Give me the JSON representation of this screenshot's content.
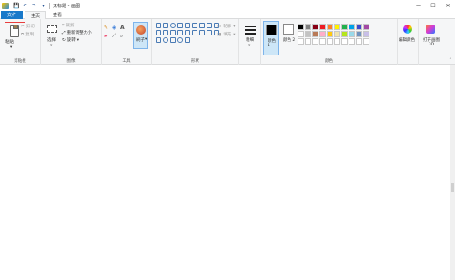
{
  "titlebar": {
    "title": "无标题 - 画图",
    "quick_access": [
      "save-icon",
      "undo-icon",
      "redo-icon",
      "customize-icon"
    ],
    "window_controls": {
      "minimize": "—",
      "maximize": "☐",
      "close": "✕"
    }
  },
  "tabs": {
    "file": "文件",
    "home": "主页",
    "view": "查看"
  },
  "clipboard": {
    "paste": "粘贴",
    "cut": "剪切",
    "copy": "复制",
    "group_label": "剪贴板"
  },
  "image": {
    "select": "选择",
    "crop": "裁剪",
    "resize": "重新调整大小",
    "rotate": "旋转",
    "group_label": "图像"
  },
  "tools": {
    "group_label": "工具",
    "brushes": "刷子"
  },
  "shapes": {
    "outline": "轮廓",
    "fill": "填充",
    "group_label": "形状"
  },
  "size": {
    "label": "粗细"
  },
  "colors": {
    "color1": "颜色 1",
    "color2": "颜色 2",
    "edit_colors": "编辑颜色",
    "paint3d": "打开画图 3D",
    "group_label": "颜色",
    "color1_value": "#000000",
    "color2_value": "#ffffff",
    "palette": [
      "#000000",
      "#7f7f7f",
      "#880015",
      "#ed1c24",
      "#ff7f27",
      "#fff200",
      "#22b14c",
      "#00a2e8",
      "#3f48cc",
      "#a349a4",
      "#ffffff",
      "#c3c3c3",
      "#b97a57",
      "#ffaec9",
      "#ffc90e",
      "#efe4b0",
      "#b5e61d",
      "#99d9ea",
      "#7092be",
      "#c8bfe7",
      "#ffffff",
      "#ffffff",
      "#ffffff",
      "#ffffff",
      "#ffffff",
      "#ffffff",
      "#ffffff",
      "#ffffff",
      "#ffffff",
      "#ffffff"
    ]
  },
  "accent": "#1979ca"
}
